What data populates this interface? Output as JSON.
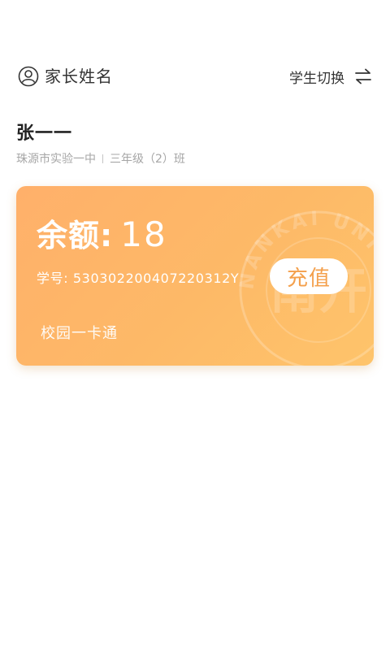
{
  "header": {
    "parent_name": "家长姓名",
    "switch_label": "学生切换",
    "avatar_icon": "user-circle-icon",
    "switch_icon": "swap-arrows-icon"
  },
  "student": {
    "name": "张一一",
    "school": "珠源市实验一中",
    "class": "三年级（2）班"
  },
  "card": {
    "balance_label": "余额",
    "balance_colon": ":",
    "balance_value": "18",
    "student_id_label": "学号: ",
    "student_id": "53030220040722031​2Y",
    "topup_label": "充值",
    "card_type": "校园一卡通",
    "watermark_text": "NANKAI UNIVERSITY",
    "watermark_glyph": "南开",
    "gradient_start": "#ffb06a",
    "gradient_end": "#fec46b",
    "button_text_color": "#f4a04c"
  }
}
